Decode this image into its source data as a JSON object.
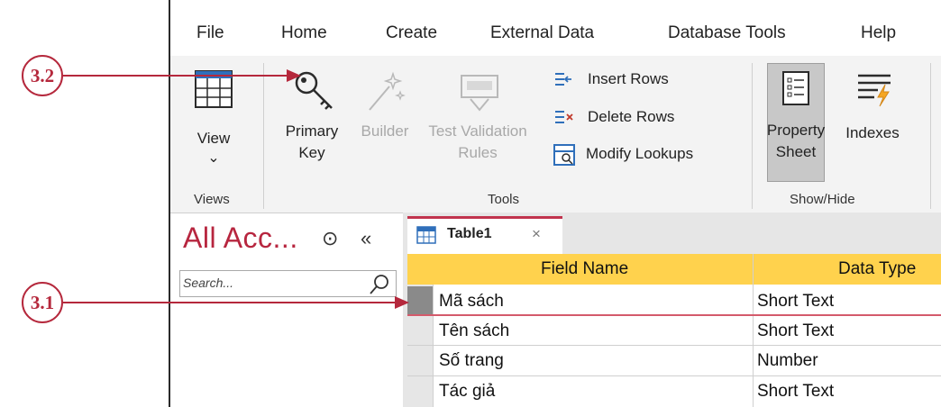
{
  "menu": [
    "File",
    "Home",
    "Create",
    "External Data",
    "Database Tools",
    "Help"
  ],
  "ribbon": {
    "view_label": "View",
    "view_chevron": "⌄",
    "primary_key_line1": "Primary",
    "primary_key_line2": "Key",
    "builder_label": "Builder",
    "test_validation_line1": "Test Validation",
    "test_validation_line2": "Rules",
    "insert_rows": "Insert Rows",
    "delete_rows": "Delete Rows",
    "modify_lookups": "Modify Lookups",
    "property_sheet_line1": "Property",
    "property_sheet_line2": "Sheet",
    "indexes_label": "Indexes",
    "groups": [
      "Views",
      "Tools",
      "Show/Hide"
    ]
  },
  "nav_pane": {
    "title": "All Acc...",
    "toggle_glyph": "⊙",
    "collapse_glyph": "«",
    "search_placeholder": "Search..."
  },
  "tab": {
    "label": "Table1",
    "close_glyph": "×"
  },
  "table": {
    "headers": [
      "Field Name",
      "Data Type"
    ],
    "rows": [
      [
        "Mã sách",
        "Short Text"
      ],
      [
        "Tên sách",
        "Short Text"
      ],
      [
        "Số trang",
        "Number"
      ],
      [
        "Tác giả",
        "Short Text"
      ]
    ]
  },
  "annotations": [
    "3.2",
    "3.1"
  ],
  "colors": {
    "accent": "#b7263f",
    "header": "#ffd24d",
    "annotation": "#b5283c"
  }
}
